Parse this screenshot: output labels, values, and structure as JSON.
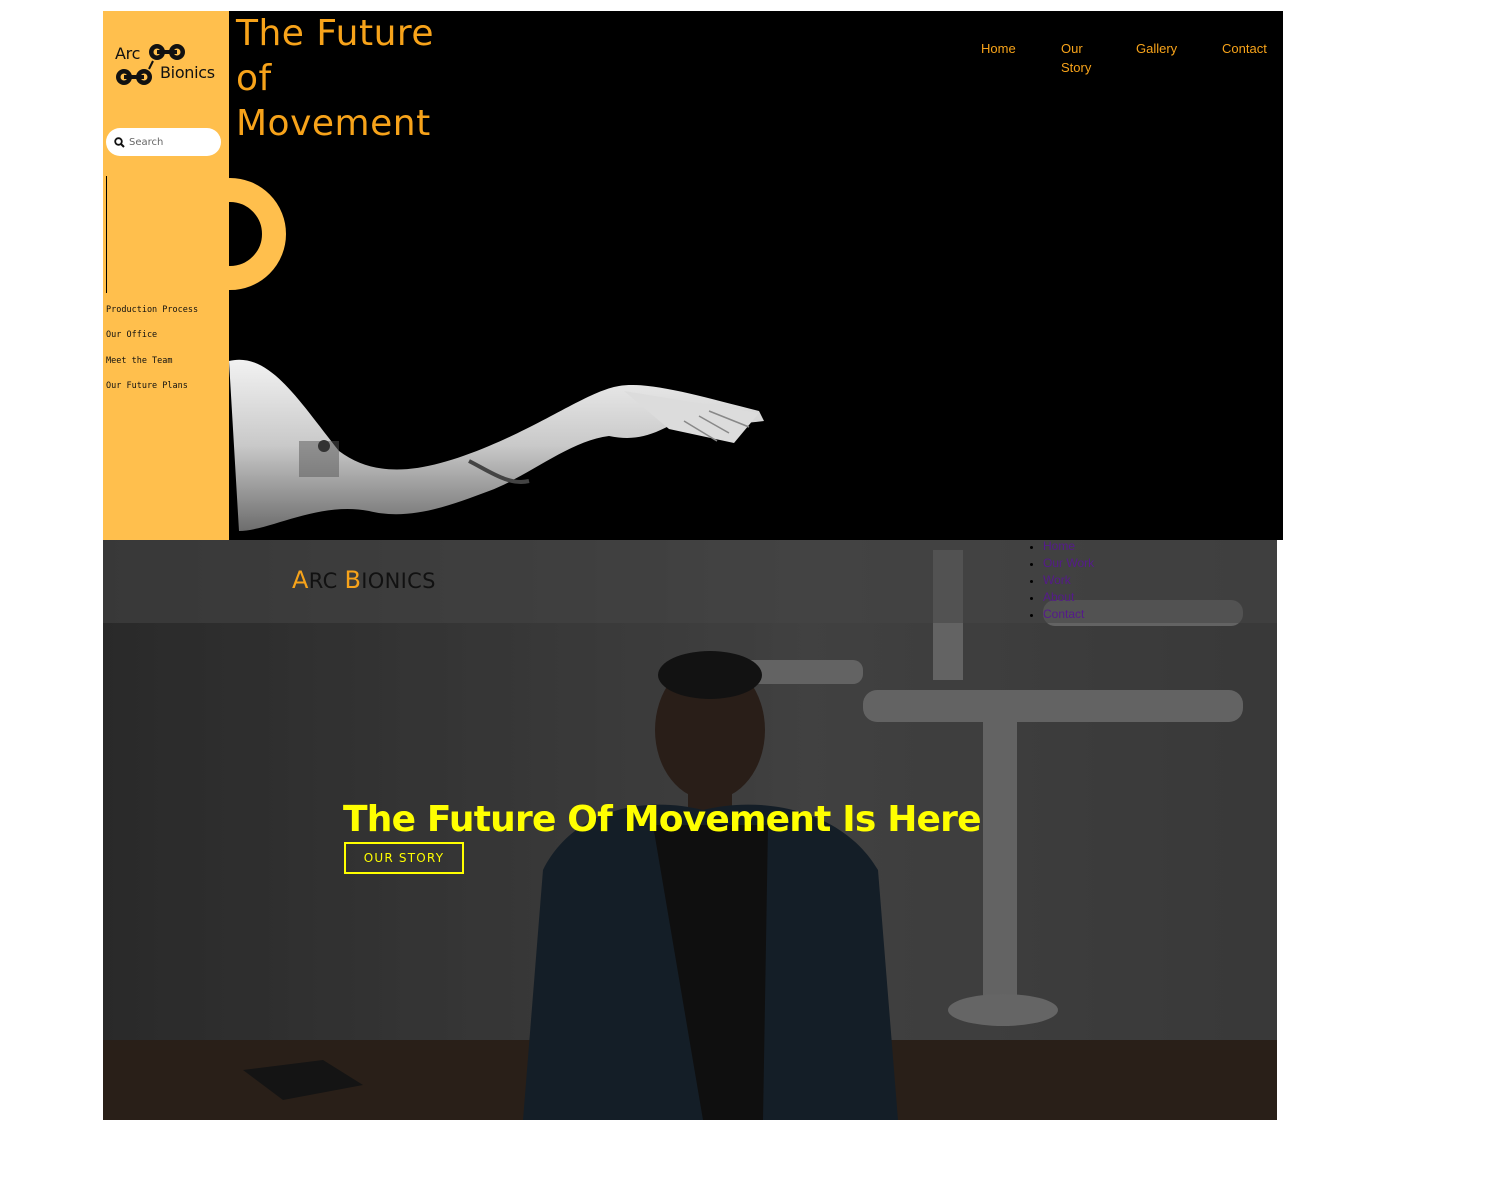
{
  "top": {
    "logo": {
      "word1": "Arc",
      "word2": "Bionics"
    },
    "search": {
      "placeholder": "Search"
    },
    "sidebar_links": [
      "Production Process",
      "Our Office",
      "Meet the Team",
      "Our Future Plans"
    ],
    "hero_title": "The Future of Movement",
    "nav": [
      {
        "label": "Home"
      },
      {
        "label": "Our Story"
      },
      {
        "label": "Gallery"
      },
      {
        "label": "Contact"
      }
    ],
    "colors": {
      "accent": "#f7a31a",
      "sidebar_bg": "#ffbf4d",
      "background": "#000000"
    }
  },
  "bottom": {
    "brand": {
      "letter1": "A",
      "rest1": "RC ",
      "letter2": "B",
      "rest2": "IONICS"
    },
    "nav": [
      {
        "label": "Home"
      },
      {
        "label": "Our Work"
      },
      {
        "label": "Work"
      },
      {
        "label": "About"
      },
      {
        "label": "Contact"
      }
    ],
    "headline": "The Future Of Movement Is Here",
    "cta_label": "OUR STORY",
    "colors": {
      "headline": "#ffff00",
      "link": "#551a8b",
      "brand_accent": "#f7a31a"
    }
  }
}
